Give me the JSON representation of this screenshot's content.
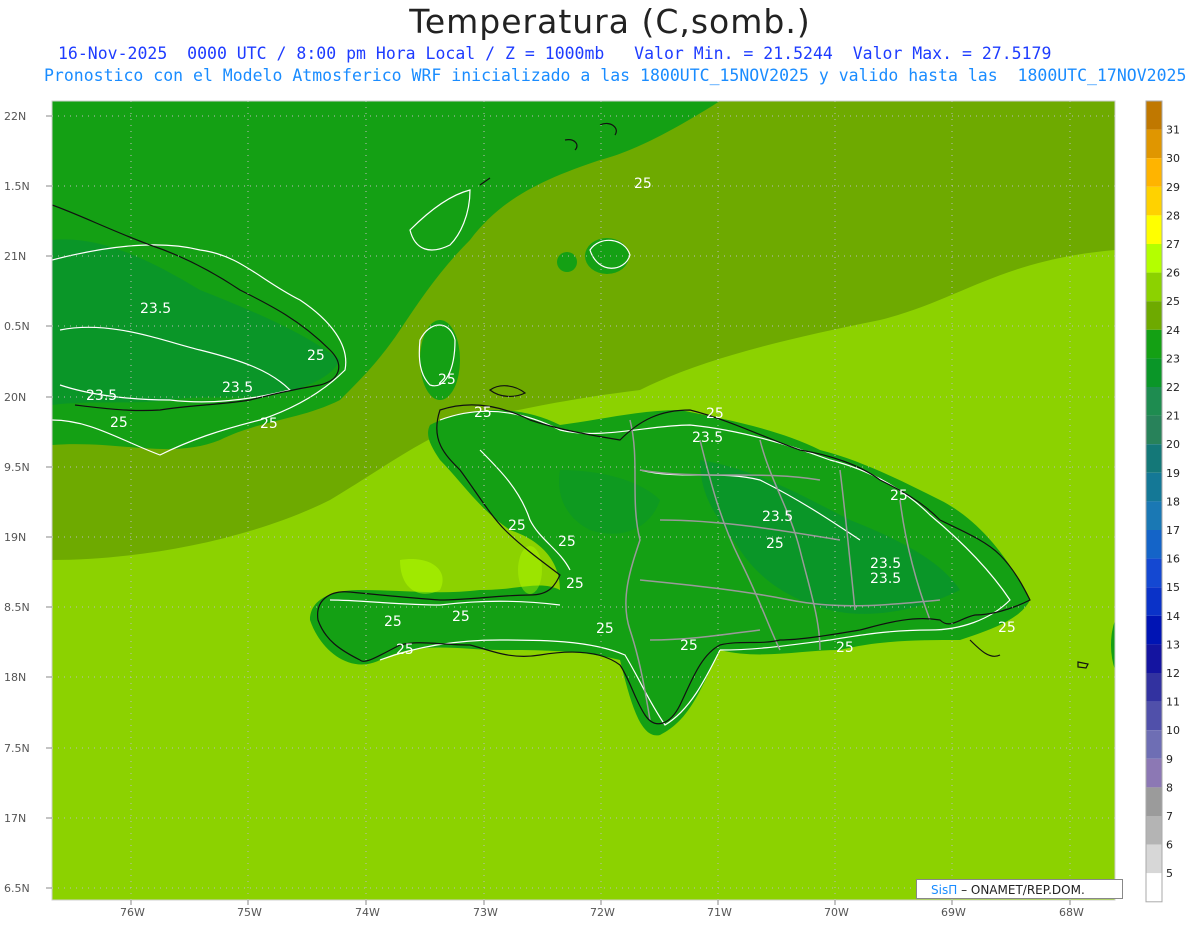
{
  "title": "Temperatura (C,somb.)",
  "subtitle_line1": "16-Nov-2025  0000 UTC / 8:00 pm Hora Local / Z = 1000mb   Valor Min. = 21.5244  Valor Max. = 27.5179",
  "subtitle_line2": "Pronostico con el Modelo Atmosferico WRF inicializado a las 1800UTC_15NOV2025 y valido hasta las  1800UTC_17NOV2025",
  "lat_labels": [
    "22N",
    "1.5N",
    "21N",
    "0.5N",
    "20N",
    "9.5N",
    "19N",
    "8.5N",
    "18N",
    "7.5N",
    "17N",
    "6.5N"
  ],
  "lon_labels": [
    "76W",
    "75W",
    "74W",
    "73W",
    "72W",
    "71W",
    "70W",
    "69W",
    "68W"
  ],
  "colorbar_labels": [
    "31",
    "30",
    "29",
    "28",
    "27",
    "26",
    "25",
    "24",
    "23",
    "22",
    "21",
    "20",
    "19",
    "18",
    "17",
    "16",
    "15",
    "14",
    "13",
    "12",
    "11",
    "10",
    "9",
    "8",
    "7",
    "6",
    "5"
  ],
  "colorbar_colors": [
    "#c07800",
    "#e09600",
    "#ffb400",
    "#ffd200",
    "#ffff00",
    "#b4ff00",
    "#8cd200",
    "#6eaa00",
    "#14a014",
    "#0a9628",
    "#1e8c50",
    "#28825a",
    "#147878",
    "#147896",
    "#1a78b4",
    "#1464c8",
    "#1448d2",
    "#0a32c8",
    "#0014b4",
    "#1414a0",
    "#3232a0",
    "#5050aa",
    "#6e6eb4",
    "#8c78b4",
    "#9b9b9b",
    "#b4b4b4",
    "#d7d7d7",
    "#ffffff"
  ],
  "contour_labels": [
    "25",
    "23.5",
    "25",
    "23.5",
    "23.5",
    "25",
    "25",
    "25",
    "25",
    "25",
    "23.5",
    "25",
    "25",
    "23.5",
    "25",
    "23.5",
    "23.5",
    "25",
    "25",
    "25",
    "25",
    "25",
    "25"
  ],
  "credit": {
    "logo": "SisΠ",
    "text": "– ONAMET/REP.DOM."
  }
}
